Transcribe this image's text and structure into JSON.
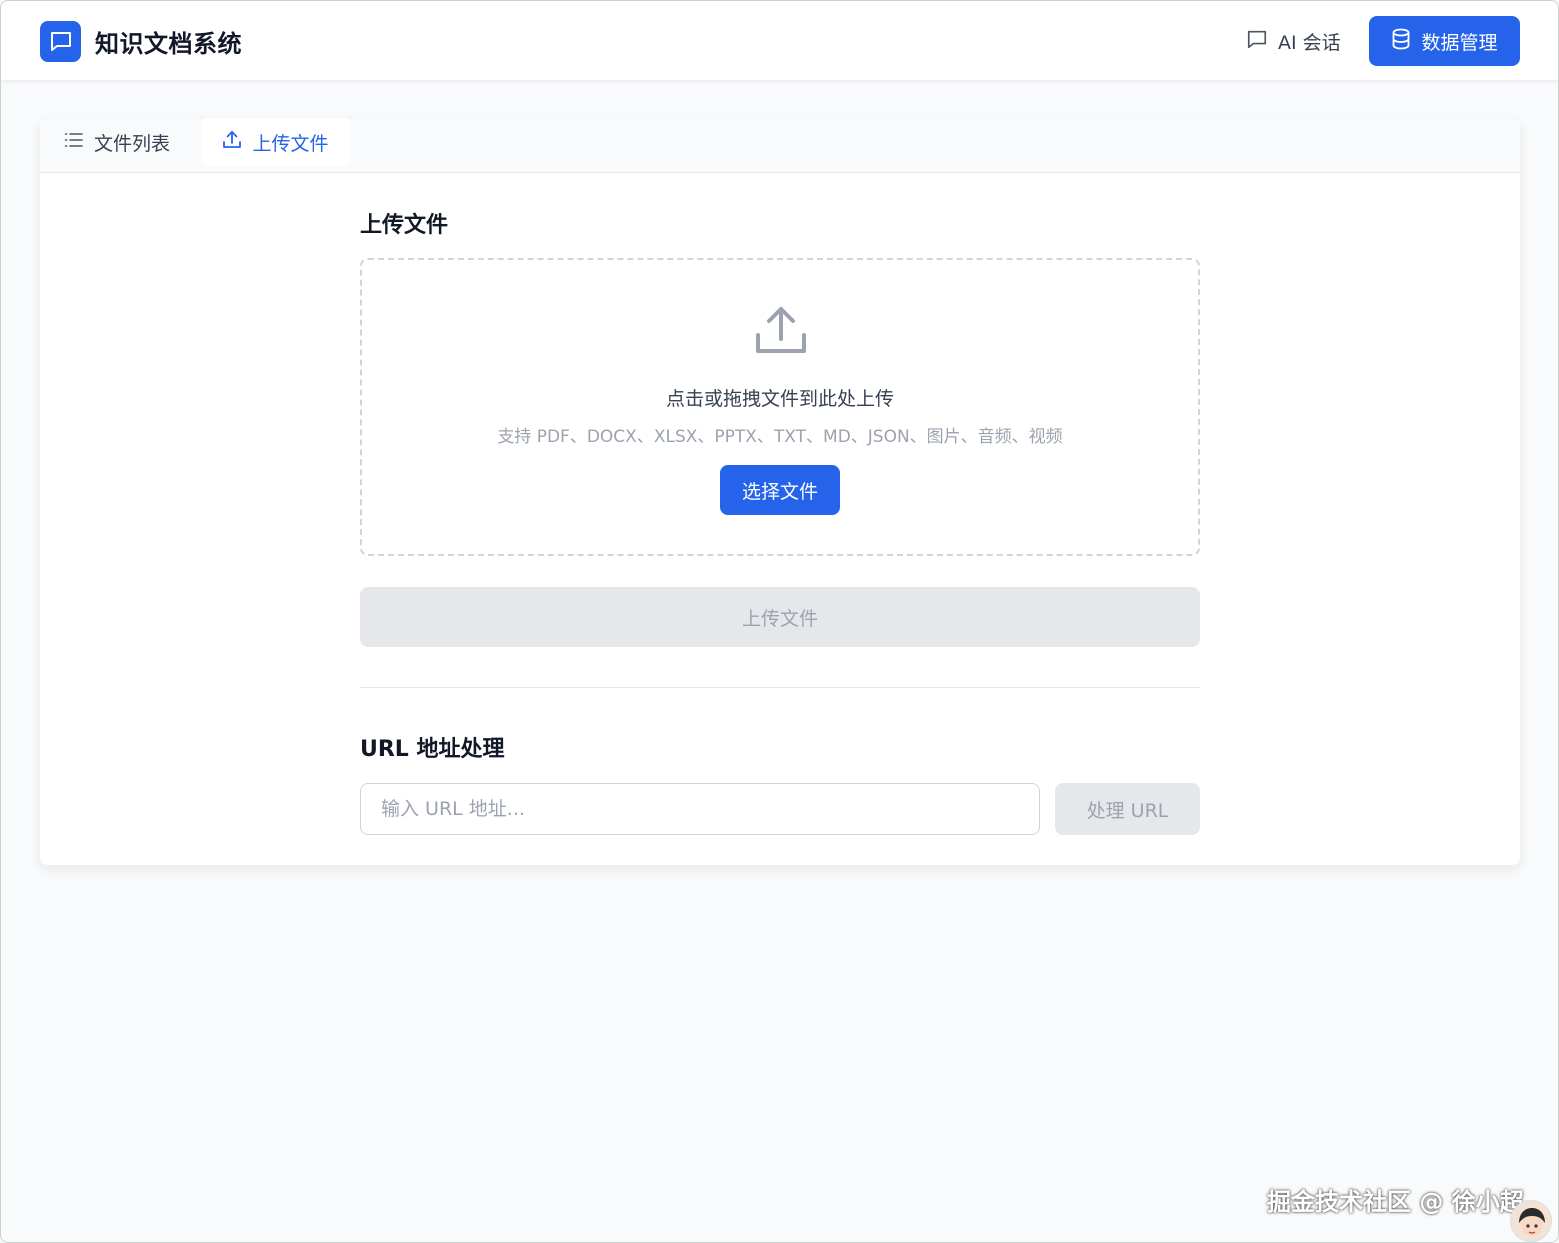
{
  "header": {
    "app_title": "知识文档系统",
    "logo_icon": "chat-bubble-icon",
    "nav_chat_label": "AI 会话",
    "nav_chat_icon": "message-square-icon",
    "nav_data_label": "数据管理",
    "nav_data_icon": "database-icon",
    "accent_color": "#2563eb"
  },
  "tabs": [
    {
      "label": "文件列表",
      "icon": "list-icon",
      "active": false
    },
    {
      "label": "上传文件",
      "icon": "upload-icon",
      "active": true
    }
  ],
  "upload": {
    "title": "上传文件",
    "dropzone_main": "点击或拖拽文件到此处上传",
    "dropzone_sub": "支持 PDF、DOCX、XLSX、PPTX、TXT、MD、JSON、图片、音频、视频",
    "choose_button": "选择文件",
    "submit_button": "上传文件",
    "submit_disabled": true
  },
  "url": {
    "title": "URL 地址处理",
    "placeholder": "输入 URL 地址...",
    "value": "",
    "button": "处理 URL",
    "button_disabled": true
  },
  "watermark": {
    "text": "掘金技术社区 @ 徐小超"
  }
}
